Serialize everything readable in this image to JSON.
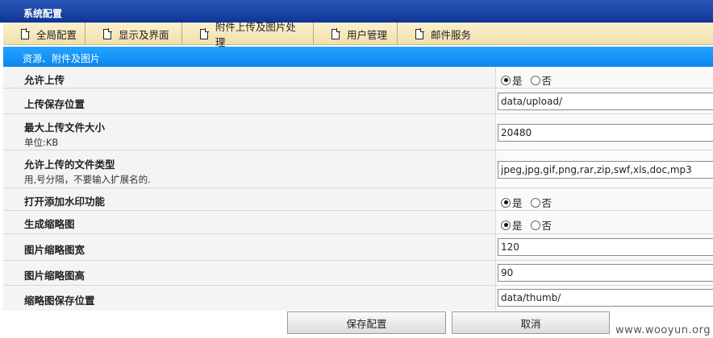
{
  "window": {
    "title": "系统配置"
  },
  "tabs": [
    {
      "label": "全局配置"
    },
    {
      "label": "显示及界面"
    },
    {
      "label": "附件上传及图片处理"
    },
    {
      "label": "用户管理"
    },
    {
      "label": "邮件服务"
    }
  ],
  "section": {
    "title": "资源、附件及图片"
  },
  "radio_labels": {
    "yes": "是",
    "no": "否"
  },
  "settings": {
    "allow_upload": {
      "label": "允许上传",
      "selected": "是"
    },
    "upload_path": {
      "label": "上传保存位置",
      "value": "data/upload/"
    },
    "max_size": {
      "label": "最大上传文件大小",
      "hint": "单位:KB",
      "value": "20480"
    },
    "file_types": {
      "label": "允许上传的文件类型",
      "hint": "用,号分隔，不要输入扩展名的.",
      "value": "jpeg,jpg,gif,png,rar,zip,swf,xls,doc,mp3"
    },
    "watermark": {
      "label": "打开添加水印功能",
      "selected": "是"
    },
    "thumbnail": {
      "label": "生成缩略图",
      "selected": "是"
    },
    "thumb_width": {
      "label": "图片缩略图宽",
      "value": "120"
    },
    "thumb_height": {
      "label": "图片缩略图高",
      "value": "90"
    },
    "thumb_path": {
      "label": "缩略图保存位置",
      "value": "data/thumb/"
    }
  },
  "buttons": {
    "save": "保存配置",
    "cancel": "取消"
  },
  "footer": {
    "watermark": "www.wooyun.org"
  }
}
